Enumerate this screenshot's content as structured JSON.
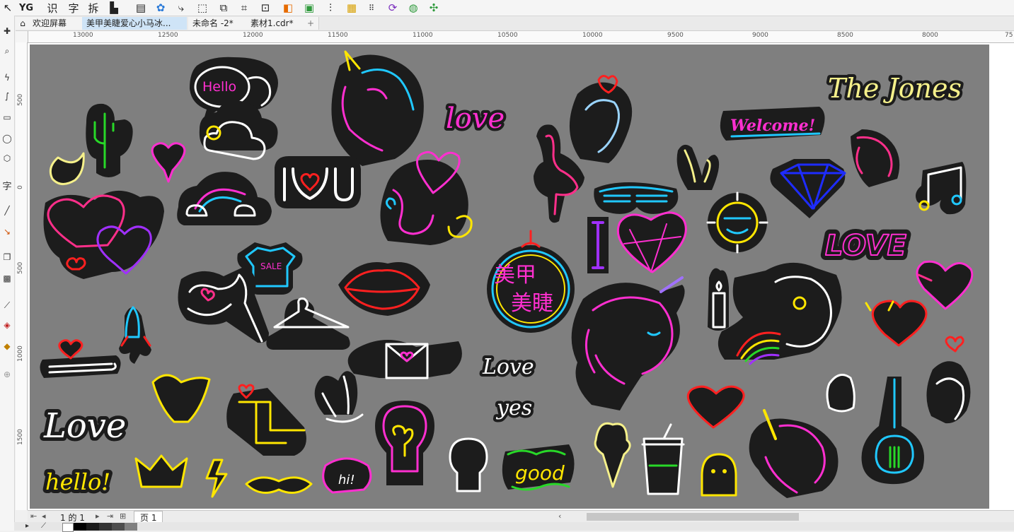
{
  "toolbar": {
    "icons": [
      "yg-logo",
      "text-recognize-icon",
      "char-icon",
      "split-icon",
      "page-icon",
      "table-icon",
      "plugin-icon",
      "trace-icon",
      "select-icon",
      "transform-icon",
      "color-icon",
      "image-icon",
      "align-icon",
      "layer-icon",
      "grid-icon",
      "fill-icon",
      "brush-icon",
      "puzzle-icon"
    ],
    "yg_label": "YG",
    "shi_label": "识",
    "zi_label": "字",
    "chai_label": "拆"
  },
  "tabs": [
    {
      "label": "欢迎屏幕"
    },
    {
      "label": "美甲美睫爱心小马冰..."
    },
    {
      "label": "未命名 -2*"
    },
    {
      "label": "素材1.cdr*"
    },
    {
      "label": "+"
    }
  ],
  "left_tools": {
    "text_tool_label": "字"
  },
  "hruler": [
    "13000",
    "12500",
    "12000",
    "11500",
    "11000",
    "10500",
    "10000",
    "9500",
    "9000",
    "8500",
    "8000",
    "75"
  ],
  "vruler": [
    "500",
    "0",
    "500",
    "1000",
    "1500"
  ],
  "stickers": {
    "hello_bubble": "Hello",
    "love_script": "love",
    "the_jones": "The Jones",
    "welcome": "Welcome!",
    "sale": "SALE",
    "love_caps": "LOVE",
    "meijia": "美甲",
    "meijie": "美睫",
    "love_small": "Love",
    "yes": "yes",
    "love_big": "Love",
    "hello_small": "hello!",
    "hi": "hi!",
    "good": "good"
  },
  "pagebar": {
    "page_of": "1 的 1",
    "page_tab": "页 1"
  },
  "colors": {
    "canvas": "#7f7f7f",
    "sticker_bg": "#1c1c1c",
    "neon_pink": "#ff2fd0",
    "neon_cyan": "#20c8ff",
    "neon_yellow": "#ffe600",
    "neon_red": "#ff2020",
    "neon_purple": "#a030ff",
    "neon_green": "#28d828"
  }
}
